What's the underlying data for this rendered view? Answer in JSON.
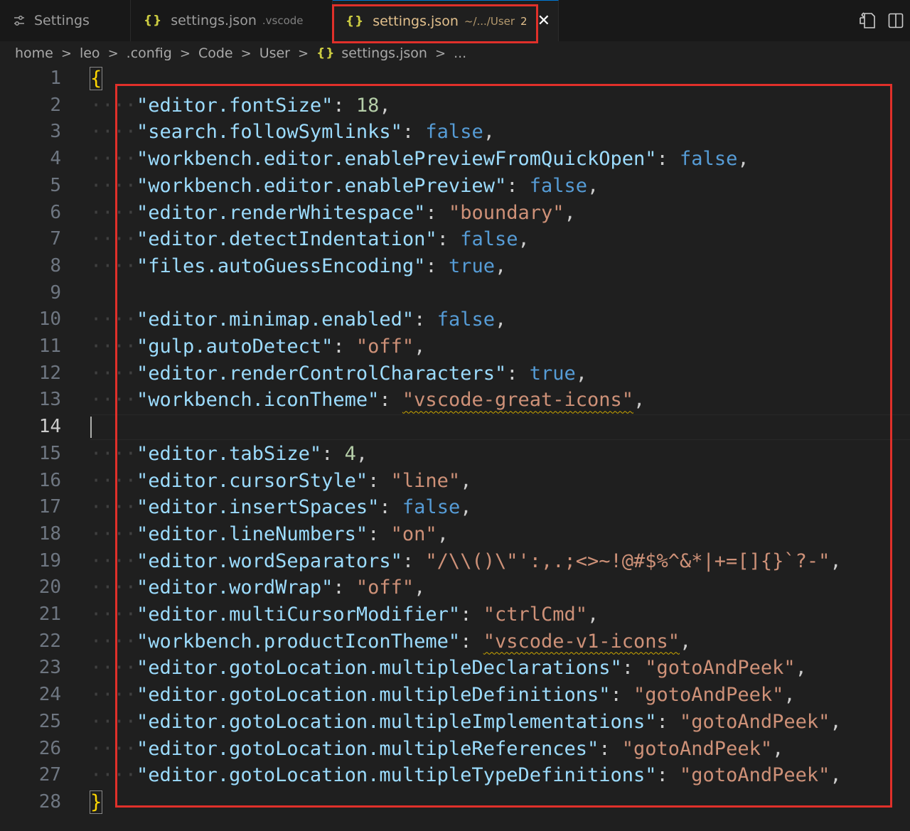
{
  "tabs": [
    {
      "label": "Settings",
      "icon": "settings-sliders-icon"
    },
    {
      "label": "settings.json",
      "description": ".vscode",
      "icon": "json-braces-icon"
    },
    {
      "label": "settings.json",
      "description": "~/.../User",
      "badge": "2",
      "icon": "json-braces-icon",
      "active": true
    }
  ],
  "tab_actions": [
    {
      "icon": "open-changes-icon"
    },
    {
      "icon": "split-editor-icon"
    }
  ],
  "close_glyph": "✕",
  "breadcrumb": {
    "segments": [
      "home",
      "leo",
      ".config",
      "Code",
      "User",
      "settings.json",
      "..."
    ],
    "separator": ">"
  },
  "editor": {
    "active_line": 14,
    "lines": [
      "{",
      "\"editor.fontSize\": 18,",
      "\"search.followSymlinks\": false,",
      "\"workbench.editor.enablePreviewFromQuickOpen\": false,",
      "\"workbench.editor.enablePreview\": false,",
      "\"editor.renderWhitespace\": \"boundary\",",
      "\"editor.detectIndentation\": false,",
      "\"files.autoGuessEncoding\": true,",
      "",
      "\"editor.minimap.enabled\": false,",
      "\"gulp.autoDetect\": \"off\",",
      "\"editor.renderControlCharacters\": true,",
      "\"workbench.iconTheme\": \"vscode-great-icons\",",
      "",
      "\"editor.tabSize\": 4,",
      "\"editor.cursorStyle\": \"line\",",
      "\"editor.insertSpaces\": false,",
      "\"editor.lineNumbers\": \"on\",",
      "\"editor.wordSeparators\": \"/\\\\()\\\"':,.;<>~!@#$%^&*|+=[]{}`?-\",",
      "\"editor.wordWrap\": \"off\",",
      "\"editor.multiCursorModifier\": \"ctrlCmd\",",
      "\"workbench.productIconTheme\": \"vscode-v1-icons\",",
      "\"editor.gotoLocation.multipleDeclarations\": \"gotoAndPeek\",",
      "\"editor.gotoLocation.multipleDefinitions\": \"gotoAndPeek\",",
      "\"editor.gotoLocation.multipleImplementations\": \"gotoAndPeek\",",
      "\"editor.gotoLocation.multipleReferences\": \"gotoAndPeek\",",
      "\"editor.gotoLocation.multipleTypeDefinitions\": \"gotoAndPeek\",",
      "}"
    ],
    "warning_values": [
      "\"vscode-great-icons\"",
      "\"vscode-v1-icons\""
    ]
  },
  "colors": {
    "key": "#9cdcfe",
    "string": "#ce9178",
    "number": "#b5cea8",
    "boolean": "#569cd6",
    "modified_tab": "#e2c08d",
    "annotation_box": "#e0302a"
  }
}
